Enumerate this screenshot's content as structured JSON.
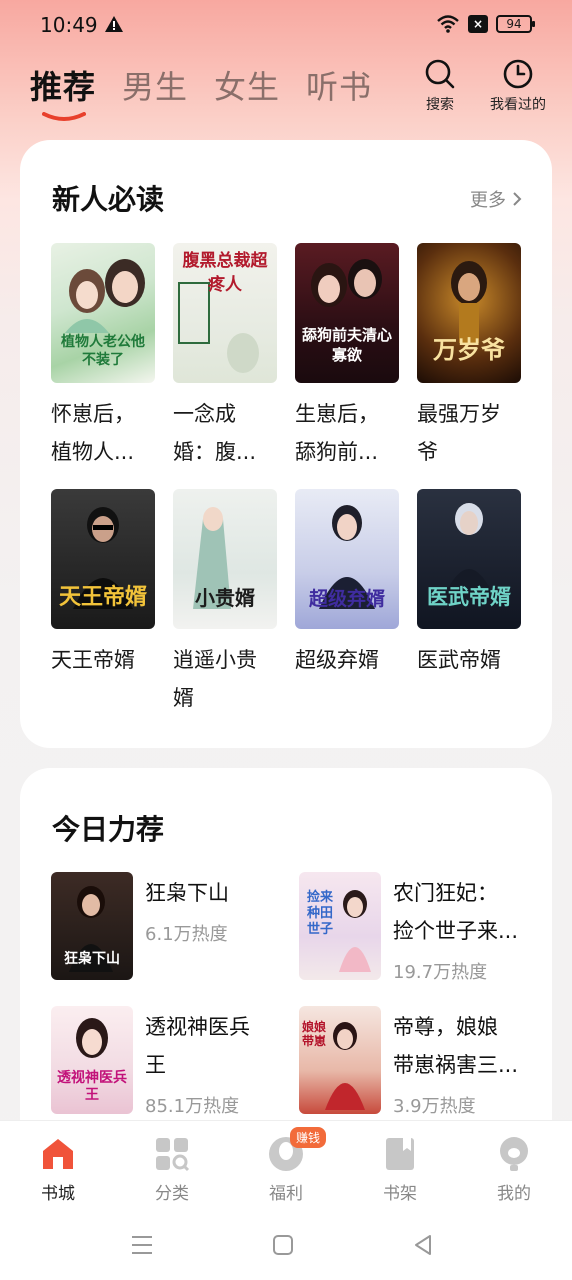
{
  "status": {
    "time": "10:49",
    "battery": "94"
  },
  "top_tabs": [
    {
      "label": "推荐",
      "active": true
    },
    {
      "label": "男生",
      "active": false
    },
    {
      "label": "女生",
      "active": false
    },
    {
      "label": "听书",
      "active": false
    }
  ],
  "actions": {
    "search": "搜索",
    "history": "我看过的"
  },
  "new_reader": {
    "title": "新人必读",
    "more": "更多",
    "books": [
      {
        "title_line1": "怀崽后，",
        "title_line2": "植物人...",
        "cover_text": "植物人老公他不装了"
      },
      {
        "title_line1": "一念成",
        "title_line2": "婚：腹...",
        "cover_text": "腹黑总裁超疼人"
      },
      {
        "title_line1": "生崽后，",
        "title_line2": "舔狗前...",
        "cover_text": "舔狗前夫清心寡欲"
      },
      {
        "title_line1": "最强万岁",
        "title_line2": "爷",
        "cover_text": "万岁爷"
      },
      {
        "title_line1": "天王帝婿",
        "title_line2": "",
        "cover_text": "天王帝婿"
      },
      {
        "title_line1": "逍遥小贵",
        "title_line2": "婿",
        "cover_text": "小贵婿"
      },
      {
        "title_line1": "超级弃婿",
        "title_line2": "",
        "cover_text": "超级弃婿"
      },
      {
        "title_line1": "医武帝婿",
        "title_line2": "",
        "cover_text": "医武帝婿"
      }
    ]
  },
  "today": {
    "title": "今日力荐",
    "items": [
      {
        "title_line1": "狂枭下山",
        "title_line2": "",
        "heat": "6.1万热度",
        "cover_text": "狂枭下山"
      },
      {
        "title_line1": "农门狂妃：",
        "title_line2": "捡个世子来...",
        "heat": "19.7万热度",
        "cover_text": "捡来种田世子"
      },
      {
        "title_line1": "透视神医兵",
        "title_line2": "王",
        "heat": "85.1万热度",
        "cover_text": "透视神医兵王"
      },
      {
        "title_line1": "帝尊，娘娘",
        "title_line2": "带崽祸害三...",
        "heat": "3.9万热度",
        "cover_text": "娘娘带崽"
      }
    ]
  },
  "bottom_nav": [
    {
      "label": "书城",
      "active": true
    },
    {
      "label": "分类",
      "active": false
    },
    {
      "label": "福利",
      "active": false,
      "badge": "赚钱"
    },
    {
      "label": "书架",
      "active": false
    },
    {
      "label": "我的",
      "active": false
    }
  ],
  "colors": {
    "accent": "#f0533a",
    "brand_underline": "#e8402c"
  }
}
